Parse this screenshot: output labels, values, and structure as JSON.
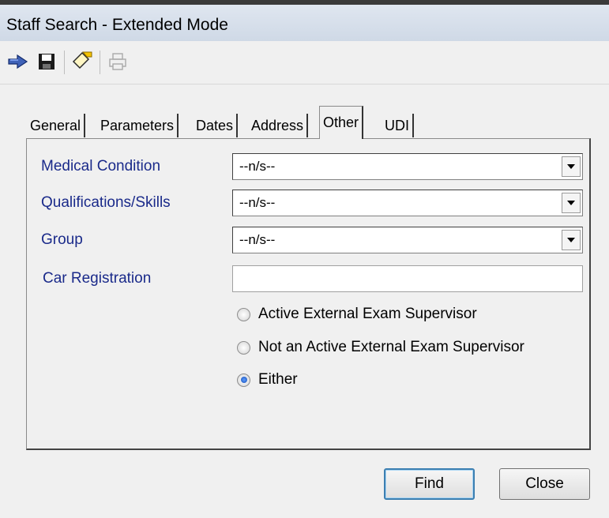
{
  "window": {
    "title": "Staff Search - Extended Mode"
  },
  "toolbar": {
    "icons": [
      "exit-icon",
      "save-icon",
      "clear-icon",
      "print-icon"
    ]
  },
  "tabs": [
    {
      "label": "General",
      "active": false
    },
    {
      "label": "Parameters",
      "active": false
    },
    {
      "label": "Dates",
      "active": false
    },
    {
      "label": "Address",
      "active": false
    },
    {
      "label": "Other",
      "active": true
    },
    {
      "label": "UDI",
      "active": false
    }
  ],
  "form": {
    "medical_condition": {
      "label": "Medical Condition",
      "value": "--n/s--"
    },
    "qualifications": {
      "label": "Qualifications/Skills",
      "value": "--n/s--"
    },
    "group": {
      "label": "Group",
      "value": "--n/s--"
    },
    "car_registration": {
      "label": "Car Registration",
      "value": ""
    },
    "supervisor_options": [
      {
        "label": "Active External Exam Supervisor",
        "selected": false
      },
      {
        "label": "Not an Active External Exam Supervisor",
        "selected": false
      },
      {
        "label": "Either",
        "selected": true
      }
    ]
  },
  "buttons": {
    "find": "Find",
    "close": "Close"
  },
  "colors": {
    "label_text": "#1a2a8a",
    "titlebar": "#cfd9e6",
    "default_button_border": "#3c7fb1"
  }
}
